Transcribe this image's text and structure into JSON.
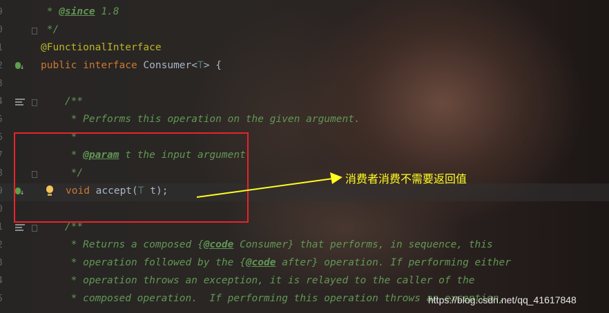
{
  "editor": {
    "lines": [
      {
        "num": "9",
        "marker": "none",
        "fold": false
      },
      {
        "num": "0",
        "marker": "none",
        "fold": true
      },
      {
        "num": "1",
        "marker": "none",
        "fold": false
      },
      {
        "num": "2",
        "marker": "implementation",
        "fold": false
      },
      {
        "num": "3",
        "marker": "none",
        "fold": false
      },
      {
        "num": "4",
        "marker": "structure",
        "fold": true
      },
      {
        "num": "5",
        "marker": "none",
        "fold": false
      },
      {
        "num": "6",
        "marker": "none",
        "fold": false
      },
      {
        "num": "7",
        "marker": "none",
        "fold": false
      },
      {
        "num": "8",
        "marker": "none",
        "fold": true
      },
      {
        "num": "9",
        "marker": "implementation",
        "fold": false
      },
      {
        "num": "0",
        "marker": "none",
        "fold": false
      },
      {
        "num": "1",
        "marker": "structure",
        "fold": true
      },
      {
        "num": "2",
        "marker": "none",
        "fold": false
      },
      {
        "num": "3",
        "marker": "none",
        "fold": false
      },
      {
        "num": "4",
        "marker": "none",
        "fold": false
      },
      {
        "num": "5",
        "marker": "none",
        "fold": false
      }
    ],
    "code": {
      "l1": {
        "prefix": " * ",
        "tag": "@since",
        "text": " 1.8"
      },
      "l2": " */",
      "l3": "@FunctionalInterface",
      "l4": {
        "kw1": "public",
        "kw2": "interface",
        "name": " Consumer<",
        "tparam": "T",
        "end": "> {"
      },
      "l5": "",
      "l6": "    /**",
      "l7": "     * Performs this operation on the given argument.",
      "l8": "     *",
      "l9": {
        "prefix": "     * ",
        "tag": "@param",
        "text": " t the input argument"
      },
      "l10": "     */",
      "l11": {
        "kw": "void",
        "name": " accept(",
        "tparam": "T",
        "end": " t);"
      },
      "l12": "",
      "l13": "    /**",
      "l14": {
        "a": "     * Returns a composed {",
        "tag": "@code",
        "b": " Consumer} that performs, in sequence, this"
      },
      "l15": {
        "a": "     * operation followed by the {",
        "tag": "@code",
        "b": " after} operation. If performing either"
      },
      "l16": "     * operation throws an exception, it is relayed to the caller of the",
      "l17": "     * composed operation.  If performing this operation throws an exception,"
    }
  },
  "annotation": {
    "callout": "消费者消费不需要返回值",
    "box_color": "#e8242a",
    "arrow_color": "#ffff22"
  },
  "watermark": "https://blog.csdn.net/qq_41617848",
  "colors": {
    "comment": "#629755",
    "keyword": "#cc7832",
    "annotation": "#bbb529",
    "type_param": "#507874",
    "text": "#a9b7c6"
  }
}
